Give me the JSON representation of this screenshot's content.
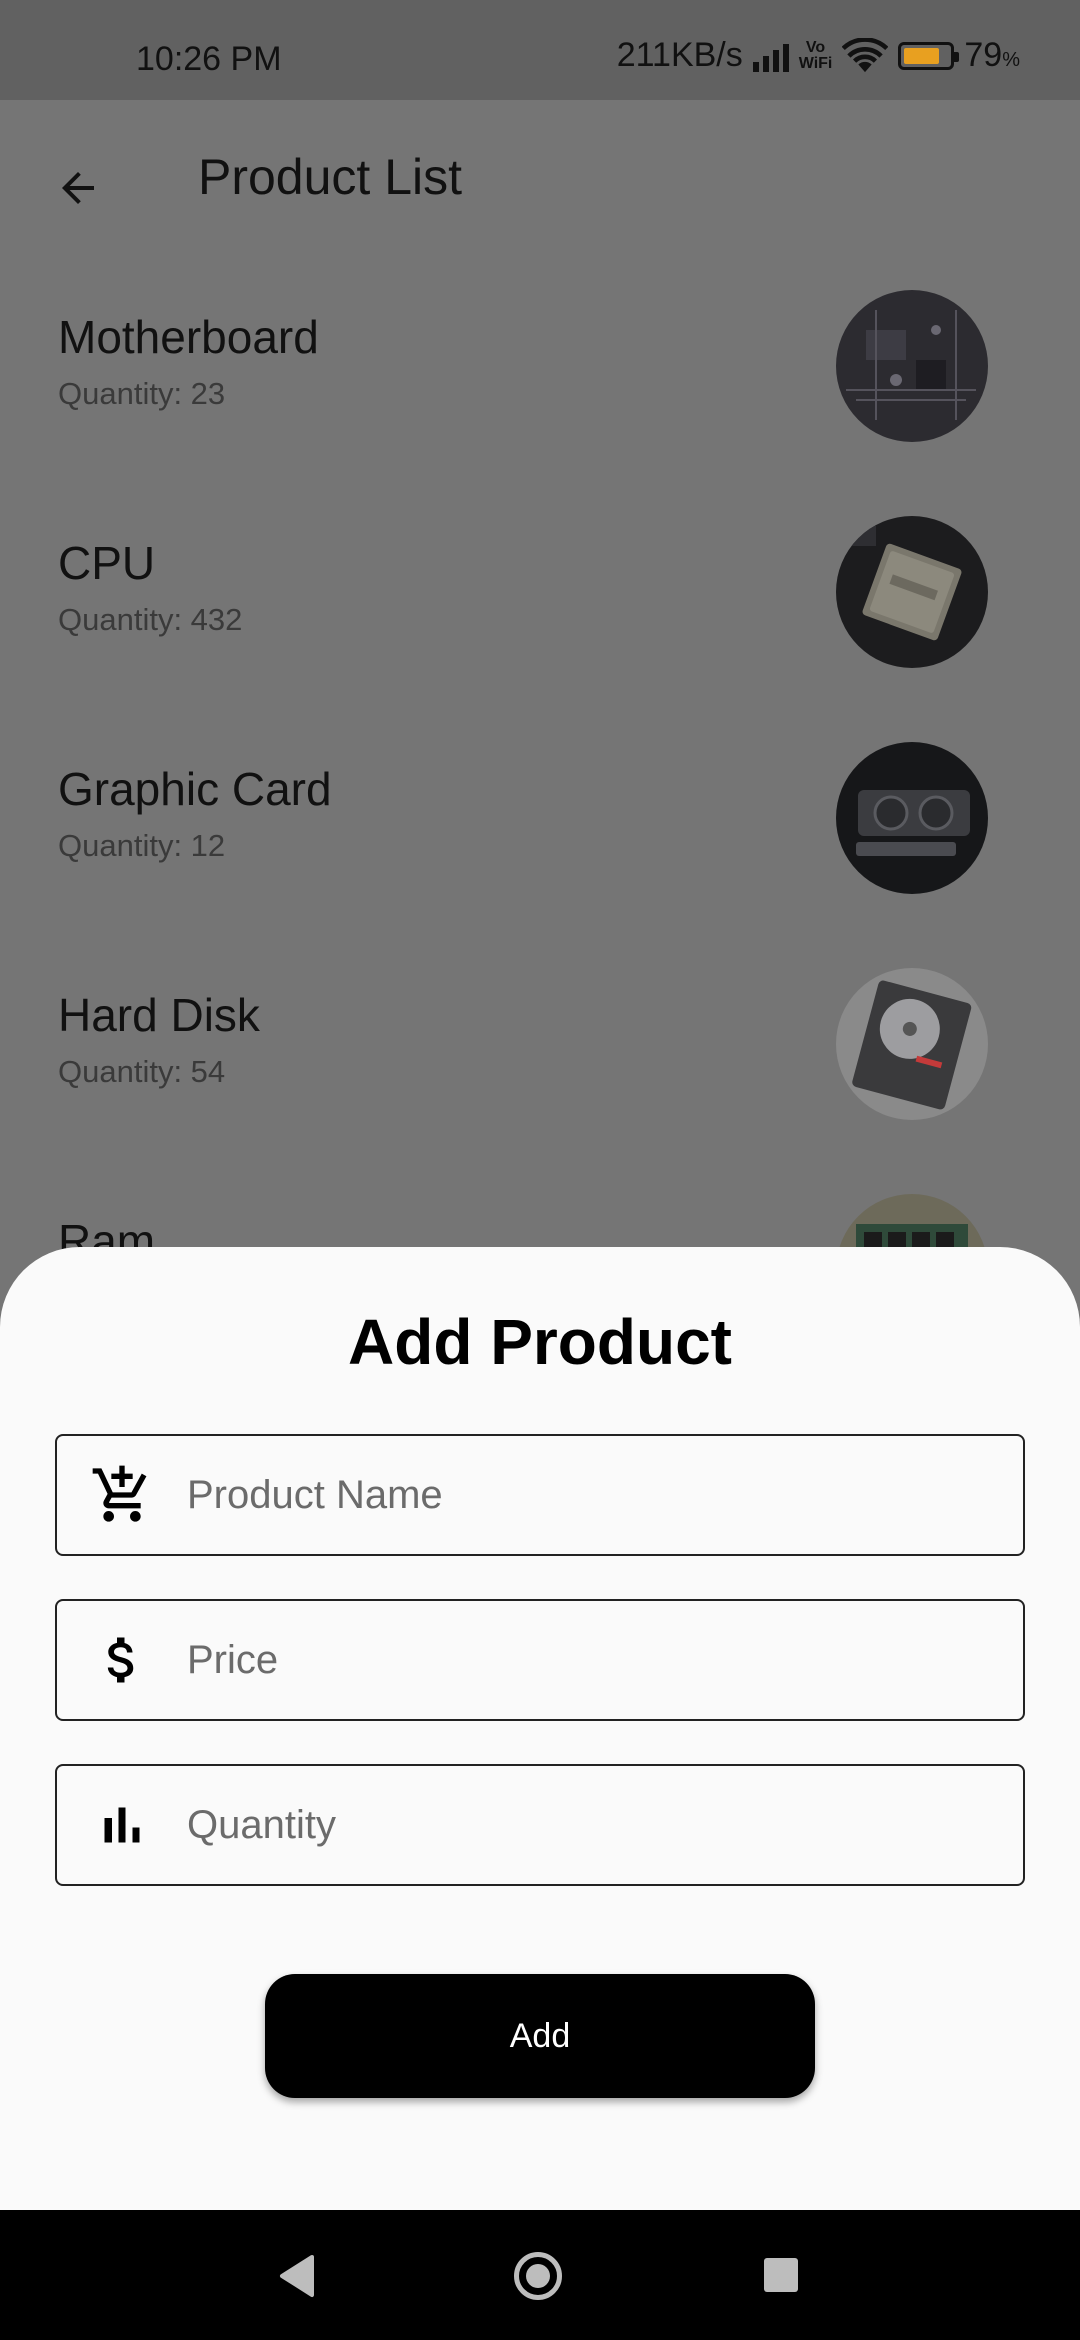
{
  "status_bar": {
    "time": "10:26 PM",
    "network_speed": "211KB/s",
    "vowifi_top": "Vo",
    "vowifi_bottom": "WiFi",
    "battery_percent": "79",
    "battery_unit": "%",
    "battery_level": 0.79
  },
  "app_bar": {
    "back_icon": "arrow-left-icon",
    "title": "Product List"
  },
  "products": [
    {
      "name": "Motherboard",
      "quantity": "Quantity: 23",
      "image": "motherboard-thumbnail"
    },
    {
      "name": "CPU",
      "quantity": "Quantity: 432",
      "image": "cpu-thumbnail"
    },
    {
      "name": "Graphic Card",
      "quantity": "Quantity: 12",
      "image": "graphic-card-thumbnail"
    },
    {
      "name": "Hard Disk",
      "quantity": "Quantity: 54",
      "image": "hard-disk-thumbnail"
    },
    {
      "name": "Ram",
      "quantity": "",
      "image": "ram-thumbnail"
    }
  ],
  "add_sheet": {
    "title": "Add Product",
    "fields": {
      "product_name": {
        "placeholder": "Product Name",
        "value": "",
        "icon": "add-shopping-cart-icon"
      },
      "price": {
        "placeholder": "Price",
        "value": "",
        "icon": "dollar-icon"
      },
      "quantity": {
        "placeholder": "Quantity",
        "value": "",
        "icon": "bar-chart-icon"
      }
    },
    "add_button_label": "Add"
  },
  "colors": {
    "scrim": "#757575",
    "sheet_background": "#fafafa",
    "button_background": "#000000",
    "battery_fill": "#e8a020"
  }
}
